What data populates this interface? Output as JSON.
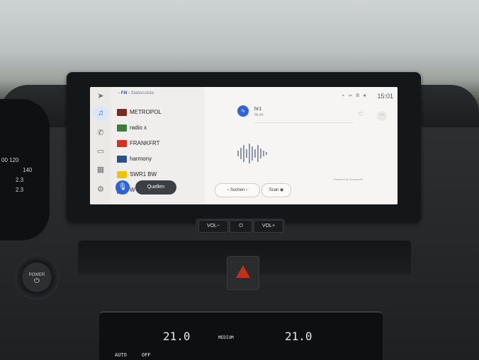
{
  "screen": {
    "breadcrumb": {
      "source": "FM",
      "section": "Stationsliste"
    },
    "clock": "15:01",
    "rail_icons": [
      "navigation-icon",
      "music-icon",
      "phone-icon",
      "car-icon",
      "apps-icon",
      "settings-icon"
    ],
    "stations": [
      {
        "name": "METROPOL",
        "logo_color": "#7a2a1d"
      },
      {
        "name": "radio x",
        "logo_color": "#3d7d3a"
      },
      {
        "name": "FRANKFRT",
        "logo_color": "#d6301f"
      },
      {
        "name": "harmony",
        "logo_color": "#2a4f8c"
      },
      {
        "name": "SWR1 BW",
        "logo_color": "#f2c300"
      },
      {
        "name": "W",
        "logo_color": "#6b6b6b"
      }
    ],
    "quellen_label": "Quellen",
    "now_playing": {
      "name": "hr1",
      "frequency": "96.40"
    },
    "buttons": {
      "search": "Suchen",
      "scan": "Scan"
    },
    "powered_by": "Powered by Gracenote",
    "accent": "#2f63d6"
  },
  "hardware": {
    "vol_down": "VOL−",
    "power": "⏻",
    "vol_up": "VOL+",
    "power_button": "POWER"
  },
  "climate": {
    "left_temp": "21.0",
    "fan": "MEDIUM",
    "right_temp": "21.0",
    "auto": "AUTO",
    "off": "OFF"
  },
  "cluster": {
    "values": [
      "00 120",
      "140",
      "2.3",
      "2.3"
    ]
  }
}
